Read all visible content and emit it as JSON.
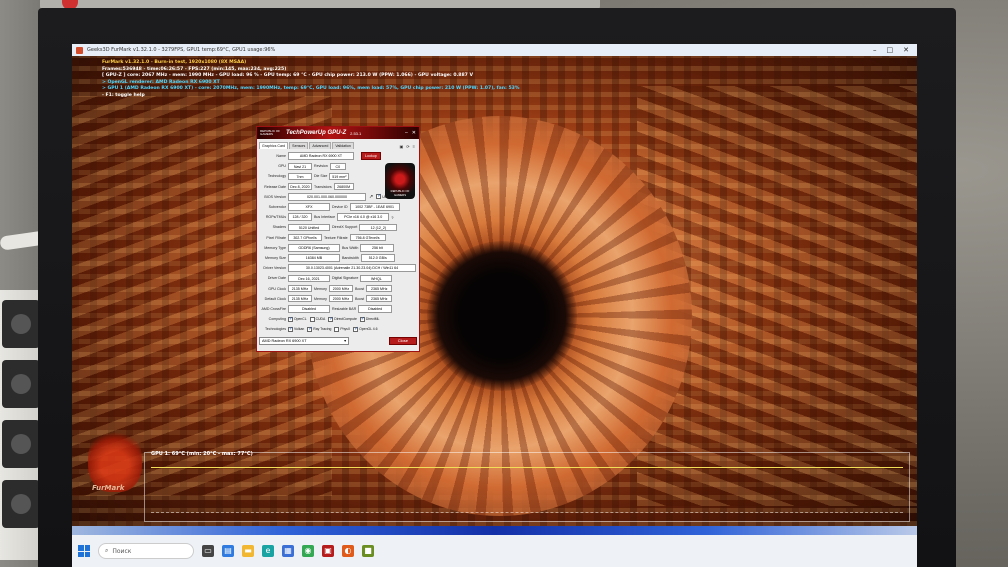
{
  "window": {
    "title": "Geeks3D FurMark v1.32.1.0 - 3279FPS, GPU1 temp:69°C, GPU1 usage:96%"
  },
  "furmark": {
    "osd_lines": [
      "FurMark v1.32.1.0 - Burn-in test, 1920x1080 (8X MSAA)",
      "Frames:536948 - time:06:26:57 - FPS:227 (min:145, max:234, avg:225)",
      "[ GPU-Z ] core: 2067 MHz - mem: 1990 MHz - GPU load: 96 % - GPU temp: 69 °C - GPU chip power: 213.0 W (PPW: 1.066) - GPU voltage: 0.887 V",
      "> OpenGL renderer: AMD Radeon RX 6900 XT",
      "> GPU 1 (AMD Radeon RX 6900 XT) - core: 2070MHz, mem: 1990MHz, temp: 69°C, GPU load: 96%, mem load: 57%, GPU chip power: 210 W (PPW: 1.07), fan: 53%",
      "- F1: toggle help"
    ],
    "graph_label": "GPU 1: 69°C (min: 20°C - max: 77°C)",
    "logo_text": "FurMark"
  },
  "gpuz": {
    "brand": "REPUBLIC OF GAMERS",
    "app_name": "TechPowerUp GPU-Z",
    "version": "2.53.1",
    "tabs": [
      "Graphics Card",
      "Sensors",
      "Advanced",
      "Validation"
    ],
    "active_tab": "Graphics Card",
    "logo_text": "REPUBLIC OF GAMERS",
    "lookup_label": "Lookup",
    "fields": {
      "name_label": "Name",
      "name": "AMD Radeon RX 6900 XT",
      "gpu_label": "GPU",
      "gpu": "Navi 21",
      "revision_label": "Revision",
      "revision": "C0",
      "technology_label": "Technology",
      "technology": "7nm",
      "die_size_label": "Die Size",
      "die_size": "519 mm²",
      "release_label": "Release Date",
      "release": "Dec 8, 2020",
      "transistors_label": "Transistors",
      "transistors": "26800M",
      "bios_label": "BIOS Version",
      "bios": "020.001.000.060.000000",
      "uefi_label": "UEFI",
      "subvendor_label": "Subvendor",
      "subvendor": "XFX",
      "device_id_label": "Device ID",
      "device_id": "1002 73BF - 1EAE 6901",
      "rops_label": "ROPs/TMUs",
      "rops": "128 / 320",
      "bus_label": "Bus Interface",
      "bus": "PCIe x16 4.0 @ x16 3.0",
      "shaders_label": "Shaders",
      "shaders": "5120 Unified",
      "dx_label": "DirectX Support",
      "dx": "12 (12_2)",
      "pixel_label": "Pixel Fillrate",
      "pixel": "302.7 GPixel/s",
      "texture_label": "Texture Fillrate",
      "texture": "756.8 GTexel/s",
      "memtype_label": "Memory Type",
      "memtype": "GDDR6 (Samsung)",
      "buswidth_label": "Bus Width",
      "buswidth": "256 bit",
      "memsize_label": "Memory Size",
      "memsize": "16384 MB",
      "bandwidth_label": "Bandwidth",
      "bandwidth": "512.0 GB/s",
      "driver_label": "Driver Version",
      "driver": "30.0.13023.4001 (Adrenalin 21.30.23.04) DCH / Win11 64",
      "driver_date_label": "Driver Date",
      "driver_date": "Dec 16, 2021",
      "digsig_label": "Digital Signature",
      "digsig": "WHQL",
      "gpu_clock_label": "GPU Clock",
      "gpu_clock": "2135 MHz",
      "memory_label": "Memory",
      "gpu_mem": "2000 MHz",
      "boost_label": "Boost",
      "gpu_boost": "2365 MHz",
      "def_clock_label": "Default Clock",
      "def_clock": "2135 MHz",
      "def_mem": "2000 MHz",
      "def_boost": "2365 MHz",
      "crossfire_label": "AMD CrossFire",
      "crossfire": "Disabled",
      "rebar_label": "Resizable BAR",
      "rebar": "Disabled",
      "computing_label": "Computing",
      "technologies_label": "Technologies"
    },
    "computing": [
      {
        "label": "OpenCL",
        "checked": true
      },
      {
        "label": "CUDA",
        "checked": false
      },
      {
        "label": "DirectCompute",
        "checked": true
      },
      {
        "label": "DirectML",
        "checked": true
      }
    ],
    "technologies": [
      {
        "label": "Vulkan",
        "checked": true
      },
      {
        "label": "Ray Tracing",
        "checked": true
      },
      {
        "label": "PhysX",
        "checked": false
      },
      {
        "label": "OpenGL 4.6",
        "checked": true
      }
    ],
    "selected_gpu": "AMD Radeon RX 6900 XT",
    "close_label": "Close"
  },
  "taskbar": {
    "search_placeholder": "Поиск",
    "icons": [
      "task-view-icon",
      "widgets-icon",
      "file-explorer-icon",
      "edge-icon",
      "store-icon",
      "chrome-icon",
      "gpuz-icon",
      "furmark-icon",
      "app-icon"
    ]
  },
  "colors": {
    "gpuz_accent": "#b71c1c",
    "osd_yellow": "#ffd24a",
    "osd_cyan": "#4fd7ff",
    "graph_line": "#f3df57"
  }
}
